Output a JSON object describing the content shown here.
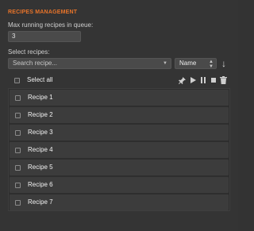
{
  "section_title": "RECIPES MANAGEMENT",
  "queue": {
    "label": "Max running recipes in queue:",
    "value": "3"
  },
  "select": {
    "label": "Select recipes:",
    "search_placeholder": "Search recipe...",
    "sort_value": "Name",
    "sort_direction_icon": "arrow-down-icon"
  },
  "select_all_label": "Select all",
  "toolbar_icons": [
    "pin-icon",
    "play-icon",
    "pause-icon",
    "stop-icon",
    "trash-icon"
  ],
  "recipes": [
    {
      "name": "Recipe 1",
      "checked": false
    },
    {
      "name": "Recipe 2",
      "checked": false
    },
    {
      "name": "Recipe 3",
      "checked": false
    },
    {
      "name": "Recipe 4",
      "checked": false
    },
    {
      "name": "Recipe 5",
      "checked": false
    },
    {
      "name": "Recipe 6",
      "checked": false
    },
    {
      "name": "Recipe 7",
      "checked": false
    }
  ],
  "colors": {
    "accent": "#e8742a",
    "background": "#343434",
    "row": "#3c3c3c"
  }
}
